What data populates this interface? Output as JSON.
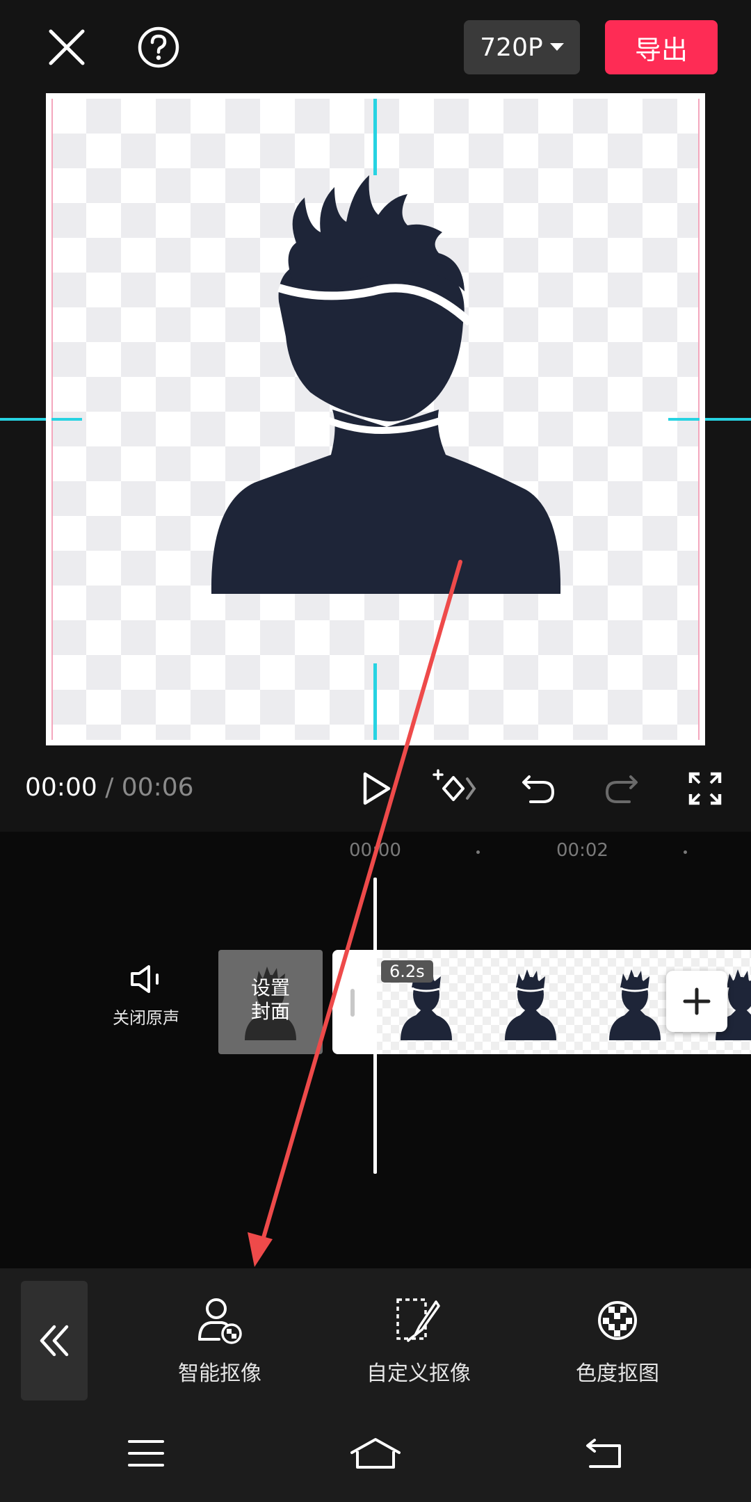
{
  "topbar": {
    "resolution": "720P",
    "export_label": "导出"
  },
  "player": {
    "current_time": "00:00",
    "separator": "/",
    "total_time": "00:06"
  },
  "timeline": {
    "ruler_labels": [
      "00:00",
      "00:02"
    ],
    "mute_label": "关闭原声",
    "cover_label": "设置\n封面",
    "clip_duration": "6.2s"
  },
  "toolbar": {
    "tools": [
      {
        "label": "智能抠像",
        "icon": "smart-cutout-icon"
      },
      {
        "label": "自定义抠像",
        "icon": "custom-cutout-icon"
      },
      {
        "label": "色度抠图",
        "icon": "chroma-key-icon"
      }
    ]
  },
  "colors": {
    "accent": "#fe2c55",
    "guide": "#27d3e2",
    "annotation_arrow": "#ee4a4a"
  }
}
